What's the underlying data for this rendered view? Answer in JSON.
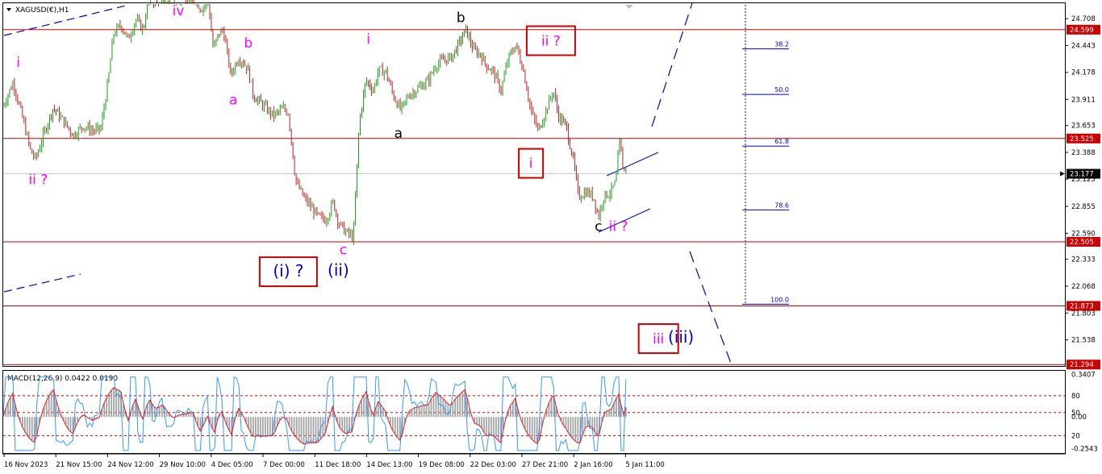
{
  "chart_data": {
    "type": "candlestick",
    "symbol_label": "XAGUSD(€),H1",
    "price_axis": {
      "ticks": [
        "24.708",
        "24.443",
        "24.178",
        "23.911",
        "23.653",
        "23.388",
        "23.125",
        "22.855",
        "22.590",
        "22.333",
        "22.068",
        "21.803",
        "21.538"
      ],
      "tick_values": [
        24.708,
        24.443,
        24.178,
        23.911,
        23.653,
        23.388,
        23.125,
        22.855,
        22.59,
        22.333,
        22.068,
        21.803,
        21.538
      ],
      "ylim": [
        21.28,
        24.86
      ]
    },
    "time_axis_labels": [
      "16 Nov 2023",
      "21 Nov 15:00",
      "24 Nov 12:00",
      "29 Nov 10:00",
      "4 Dec 05:00",
      "7 Dec 00:00",
      "11 Dec 18:00",
      "14 Dec 13:00",
      "19 Dec 08:00",
      "22 Dec 03:00",
      "27 Dec 21:00",
      "2 Jan 16:00",
      "5 Jan 11:00"
    ],
    "horizontal_levels": [
      {
        "value": 24.599,
        "label": "24.599",
        "color": "#cc0000"
      },
      {
        "value": 23.525,
        "label": "23.525",
        "color": "#cc0000"
      },
      {
        "value": 22.505,
        "label": "22.505",
        "color": "#cc0000"
      },
      {
        "value": 21.873,
        "label": "21.873",
        "color": "#cc0000"
      },
      {
        "value": 21.294,
        "label": "21.294",
        "color": "#cc0000"
      }
    ],
    "current_price": {
      "value": 23.177,
      "label": "23.177"
    },
    "fibonacci": [
      {
        "ratio": "38.2",
        "value": 24.41
      },
      {
        "ratio": "50.0",
        "value": 23.96
      },
      {
        "ratio": "61.8",
        "value": 23.45
      },
      {
        "ratio": "78.6",
        "value": 22.82
      },
      {
        "ratio": "100.0",
        "value": 21.89
      }
    ],
    "wave_labels": [
      {
        "text": "i",
        "color": "#ff00ff",
        "boxed": false,
        "t": 0.03,
        "price": 24.28
      },
      {
        "text": "ii ?",
        "color": "#ff00ff",
        "boxed": false,
        "t": 0.07,
        "price": 23.12
      },
      {
        "text": "iv",
        "color": "#ff00ff",
        "boxed": false,
        "t": 0.35,
        "price": 24.79
      },
      {
        "text": "b",
        "color": "#ff00ff",
        "boxed": false,
        "t": 0.49,
        "price": 24.47
      },
      {
        "text": "a",
        "color": "#ff00ff",
        "boxed": false,
        "t": 0.46,
        "price": 23.91
      },
      {
        "text": "c",
        "color": "#ff00ff",
        "boxed": false,
        "t": 0.68,
        "price": 22.43
      },
      {
        "text": "i",
        "color": "#ff00ff",
        "boxed": false,
        "t": 0.73,
        "price": 24.51
      },
      {
        "text": "b",
        "color": "#000000",
        "boxed": false,
        "t": 0.915,
        "price": 24.72
      },
      {
        "text": "a",
        "color": "#000000",
        "boxed": false,
        "t": 0.79,
        "price": 23.58
      },
      {
        "text": "ii ?",
        "color": "#ff00ff",
        "boxed": true,
        "t": 1.095,
        "price": 24.49
      },
      {
        "text": "i",
        "color": "#ff00ff",
        "boxed": true,
        "t": 1.055,
        "price": 23.28
      },
      {
        "text": "c",
        "color": "#000000",
        "boxed": false,
        "t": 1.19,
        "price": 22.66
      },
      {
        "text": "ii ?",
        "color": "#ff00ff",
        "boxed": false,
        "t": 1.23,
        "price": 22.66
      },
      {
        "text": "(i) ?",
        "color": "#0000cc",
        "boxed": true,
        "t": 0.57,
        "price": 22.21
      },
      {
        "text": "(ii)",
        "color": "#0000cc",
        "boxed": false,
        "t": 0.67,
        "price": 22.22
      },
      {
        "text": "iii",
        "color": "#ff00ff",
        "boxed": true,
        "t": 1.31,
        "price": 21.55
      },
      {
        "text": "(iii)",
        "color": "#0000cc",
        "boxed": false,
        "t": 1.355,
        "price": 21.56
      }
    ],
    "macd": {
      "label": "MACD(12,26,9) 0.0422 0.0190",
      "fast": 12,
      "slow": 26,
      "signal": 9,
      "macd_value": 0.0422,
      "signal_value": 0.019,
      "axis_ticks": [
        "0.3407",
        "80",
        "50",
        "0.00",
        "20",
        "-0.2543"
      ],
      "tick_values": [
        0.3407,
        0.17,
        0.035,
        0.0,
        -0.15,
        -0.2543
      ],
      "dashed_levels": [
        0.17,
        0.035,
        -0.15
      ],
      "ylim": [
        -0.29,
        0.37
      ]
    },
    "price_path": [
      [
        0.0,
        23.85
      ],
      [
        0.02,
        24.08
      ],
      [
        0.04,
        23.7
      ],
      [
        0.055,
        23.4
      ],
      [
        0.065,
        23.32
      ],
      [
        0.08,
        23.55
      ],
      [
        0.1,
        23.83
      ],
      [
        0.12,
        23.7
      ],
      [
        0.14,
        23.56
      ],
      [
        0.16,
        23.65
      ],
      [
        0.18,
        23.6
      ],
      [
        0.195,
        23.62
      ],
      [
        0.21,
        24.1
      ],
      [
        0.22,
        24.55
      ],
      [
        0.235,
        24.65
      ],
      [
        0.25,
        24.5
      ],
      [
        0.265,
        24.7
      ],
      [
        0.28,
        24.6
      ],
      [
        0.29,
        24.9
      ],
      [
        0.305,
        24.88
      ],
      [
        0.32,
        24.95
      ],
      [
        0.34,
        24.9
      ],
      [
        0.36,
        24.92
      ],
      [
        0.38,
        24.95
      ],
      [
        0.395,
        24.8
      ],
      [
        0.41,
        24.88
      ],
      [
        0.42,
        24.4
      ],
      [
        0.43,
        24.55
      ],
      [
        0.44,
        24.6
      ],
      [
        0.455,
        24.15
      ],
      [
        0.47,
        24.32
      ],
      [
        0.48,
        24.28
      ],
      [
        0.49,
        24.2
      ],
      [
        0.5,
        23.95
      ],
      [
        0.52,
        23.85
      ],
      [
        0.54,
        23.75
      ],
      [
        0.56,
        23.82
      ],
      [
        0.57,
        23.78
      ],
      [
        0.585,
        23.1
      ],
      [
        0.6,
        22.95
      ],
      [
        0.615,
        22.85
      ],
      [
        0.63,
        22.75
      ],
      [
        0.645,
        22.72
      ],
      [
        0.66,
        22.9
      ],
      [
        0.67,
        22.7
      ],
      [
        0.685,
        22.6
      ],
      [
        0.7,
        22.55
      ],
      [
        0.712,
        23.7
      ],
      [
        0.725,
        24.1
      ],
      [
        0.74,
        24.0
      ],
      [
        0.75,
        24.2
      ],
      [
        0.765,
        24.18
      ],
      [
        0.78,
        23.95
      ],
      [
        0.795,
        23.8
      ],
      [
        0.81,
        23.95
      ],
      [
        0.83,
        24.02
      ],
      [
        0.85,
        24.1
      ],
      [
        0.865,
        24.25
      ],
      [
        0.88,
        24.3
      ],
      [
        0.895,
        24.32
      ],
      [
        0.91,
        24.45
      ],
      [
        0.925,
        24.6
      ],
      [
        0.94,
        24.4
      ],
      [
        0.955,
        24.35
      ],
      [
        0.965,
        24.25
      ],
      [
        0.98,
        24.18
      ],
      [
        0.995,
        24.0
      ],
      [
        1.01,
        24.32
      ],
      [
        1.025,
        24.45
      ],
      [
        1.04,
        24.2
      ],
      [
        1.055,
        23.8
      ],
      [
        1.07,
        23.6
      ],
      [
        1.085,
        23.8
      ],
      [
        1.1,
        24.0
      ],
      [
        1.11,
        23.75
      ],
      [
        1.125,
        23.65
      ],
      [
        1.14,
        23.3
      ],
      [
        1.15,
        22.95
      ],
      [
        1.165,
        23.0
      ],
      [
        1.18,
        22.95
      ],
      [
        1.19,
        22.75
      ],
      [
        1.2,
        22.95
      ],
      [
        1.215,
        23.0
      ],
      [
        1.225,
        23.1
      ],
      [
        1.232,
        23.5
      ],
      [
        1.24,
        23.2
      ],
      [
        1.245,
        23.25
      ]
    ]
  }
}
